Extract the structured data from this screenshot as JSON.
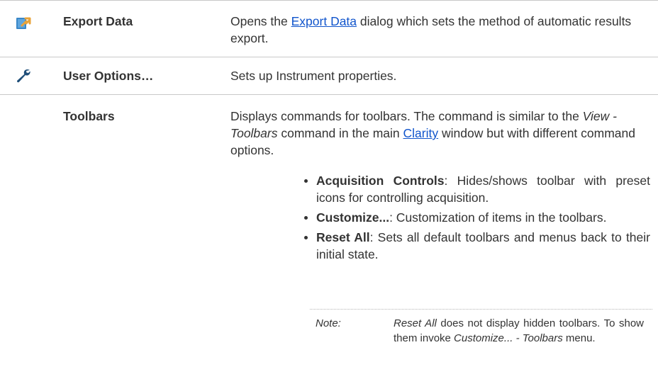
{
  "rows": [
    {
      "name": "Export Data",
      "icon": "export-data-icon",
      "desc_before": "Opens the ",
      "link": "Export Data",
      "desc_after": " dialog which sets the method of automatic results export."
    },
    {
      "name": "User Options…",
      "icon": "wrench-icon",
      "desc": "Sets up Instrument properties."
    },
    {
      "name": "Toolbars",
      "desc_1": "Displays commands for toolbars. The command is similar to the ",
      "desc_italic": "View - Toolbars",
      "desc_2": " command in the main ",
      "link": "Clarity",
      "desc_3": " window but with different command options.",
      "options": [
        {
          "label": "Acquisition Controls",
          "text": ": Hides/shows toolbar with preset icons for controlling acquisition."
        },
        {
          "label": "Customize...",
          "text": ": Customization of items in the toolbars."
        },
        {
          "label": "Reset All",
          "text": ": Sets all default toolbars and menus back to their initial state."
        }
      ],
      "note": {
        "label": "Note:",
        "italic_1": "Reset All",
        "text_1": " does not display hidden toolbars. To show them invoke ",
        "italic_2": "Customize... - Toolbars",
        "text_2": " menu."
      }
    }
  ],
  "colors": {
    "link": "#1155cc",
    "separator": "#c8c8c8",
    "icon_blue": "#3a87c8",
    "icon_orange": "#e8a33a"
  }
}
